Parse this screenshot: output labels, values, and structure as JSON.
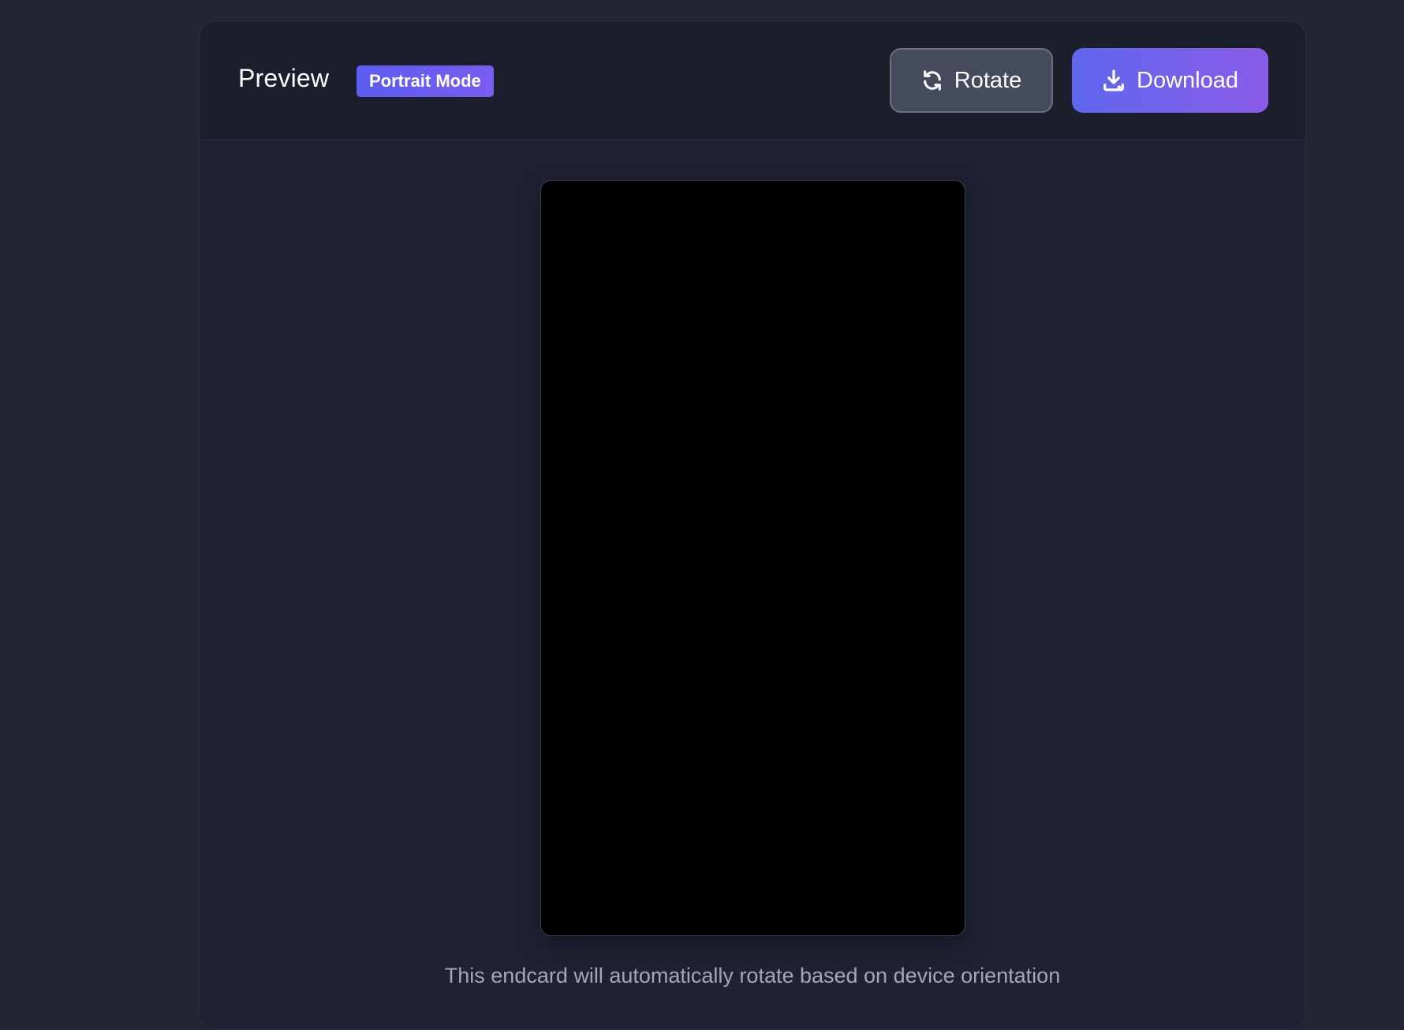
{
  "preview": {
    "title": "Preview",
    "mode_badge": "Portrait Mode",
    "caption": "This endcard will automatically rotate based on device orientation"
  },
  "toolbar": {
    "rotate_label": "Rotate",
    "rotate_icon": "rotate-icon",
    "download_label": "Download",
    "download_icon": "download-icon"
  },
  "colors": {
    "background": "#232535",
    "accent_start": "#5e66ee",
    "accent_end": "#8a5ce8",
    "rotate_button": "#454b5c",
    "stage": "#000000"
  }
}
